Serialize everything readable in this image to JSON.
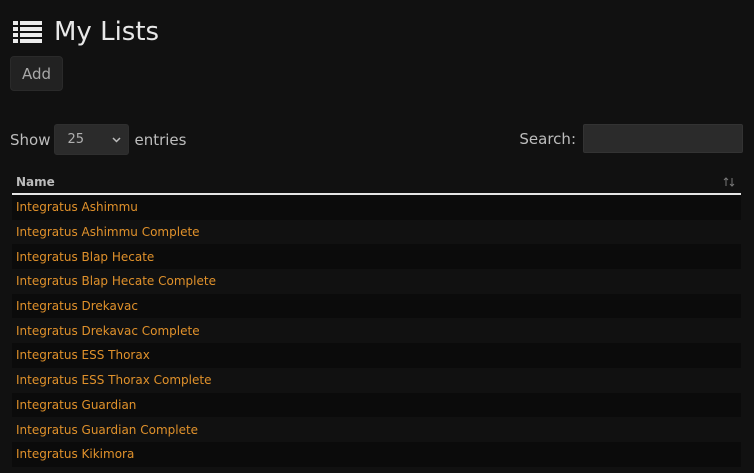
{
  "header": {
    "title": "My Lists",
    "icon": "list-icon"
  },
  "toolbar": {
    "add_label": "Add"
  },
  "length_control": {
    "prefix": "Show",
    "selected": "25",
    "suffix": "entries"
  },
  "search": {
    "label": "Search:",
    "value": ""
  },
  "table": {
    "columns": [
      "Name"
    ],
    "rows": [
      "Integratus Ashimmu",
      "Integratus Ashimmu Complete",
      "Integratus Blap Hecate",
      "Integratus Blap Hecate Complete",
      "Integratus Drekavac",
      "Integratus Drekavac Complete",
      "Integratus ESS Thorax",
      "Integratus ESS Thorax Complete",
      "Integratus Guardian",
      "Integratus Guardian Complete",
      "Integratus Kikimora"
    ]
  },
  "colors": {
    "background": "#111111",
    "link": "#e0912b",
    "row_stripe": "#0b0b0b",
    "header_rule": "#e6e6e6"
  }
}
